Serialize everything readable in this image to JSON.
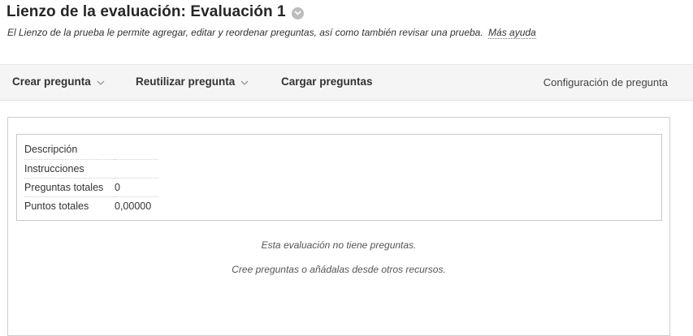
{
  "header": {
    "title": "Lienzo de la evaluación: Evaluación 1",
    "title_menu_icon": "chevron-down-circle-icon",
    "subtitle": "El Lienzo de la prueba le permite agregar, editar y reordenar preguntas, así como también revisar una prueba.",
    "help_link": "Más ayuda"
  },
  "toolbar": {
    "create_label": "Crear pregunta",
    "reuse_label": "Reutilizar pregunta",
    "upload_label": "Cargar preguntas",
    "settings_label": "Configuración de pregunta",
    "dropdown_icon": "chevron-down-icon"
  },
  "info": {
    "rows": [
      {
        "label": "Descripción",
        "value": ""
      },
      {
        "label": "Instrucciones",
        "value": ""
      },
      {
        "label": "Preguntas totales",
        "value": "0"
      },
      {
        "label": "Puntos totales",
        "value": "0,00000"
      }
    ]
  },
  "empty_state": {
    "line1": "Esta evaluación no tiene preguntas.",
    "line2": "Cree preguntas o añádalas desde otros recursos."
  },
  "colors": {
    "toolbar_bg": "#f5f5f5",
    "title_icon_bg": "#bdbdbd",
    "border": "#c8c8c8"
  }
}
